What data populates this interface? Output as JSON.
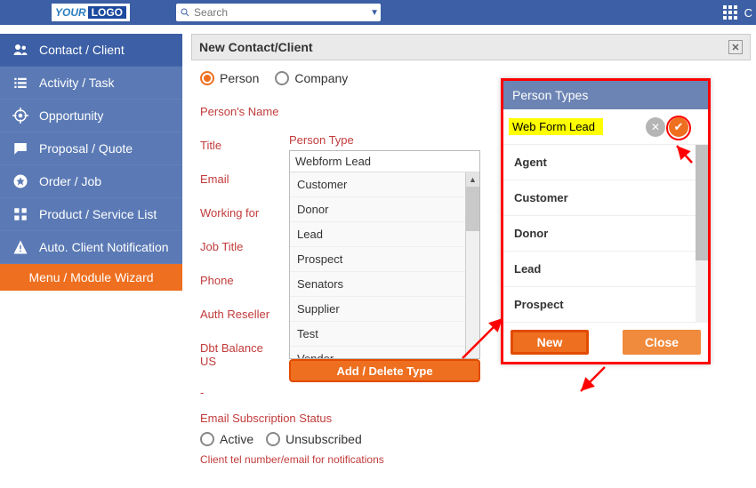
{
  "topbar": {
    "logo_your": "YOUR",
    "logo_logo": "LOGO",
    "search_placeholder": "Search",
    "right_text": "C"
  },
  "sidebar": {
    "items": [
      {
        "label": "Contact / Client",
        "active": true
      },
      {
        "label": "Activity / Task"
      },
      {
        "label": "Opportunity"
      },
      {
        "label": "Proposal / Quote"
      },
      {
        "label": "Order / Job"
      },
      {
        "label": "Product / Service List"
      },
      {
        "label": "Auto. Client Notification"
      }
    ],
    "wizard": "Menu / Module Wizard"
  },
  "panel": {
    "title": "New Contact/Client",
    "entity_types": {
      "person": "Person",
      "company": "Company"
    },
    "labels": {
      "persons_name": "Person's Name",
      "title": "Title",
      "email": "Email",
      "working_for": "Working for",
      "job_title": "Job Title",
      "phone": "Phone",
      "auth_reseller": "Auth Reseller",
      "dbt_balance": "Dbt Balance US",
      "person_type": "Person Type",
      "add_delete": "Add / Delete Type",
      "subscription": "Email Subscription Status",
      "active": "Active",
      "unsubscribed": "Unsubscribed",
      "tel_note": "Client tel number/email for notifications",
      "selected_type": "Webform Lead"
    },
    "type_options": [
      "Customer",
      "Donor",
      "Lead",
      "Prospect",
      "Senators",
      "Supplier",
      "Test",
      "Vendor"
    ]
  },
  "popup": {
    "title": "Person Types",
    "new_value": "Web Form Lead",
    "items": [
      "Agent",
      "Customer",
      "Donor",
      "Lead",
      "Prospect"
    ],
    "btn_new": "New",
    "btn_close": "Close"
  }
}
